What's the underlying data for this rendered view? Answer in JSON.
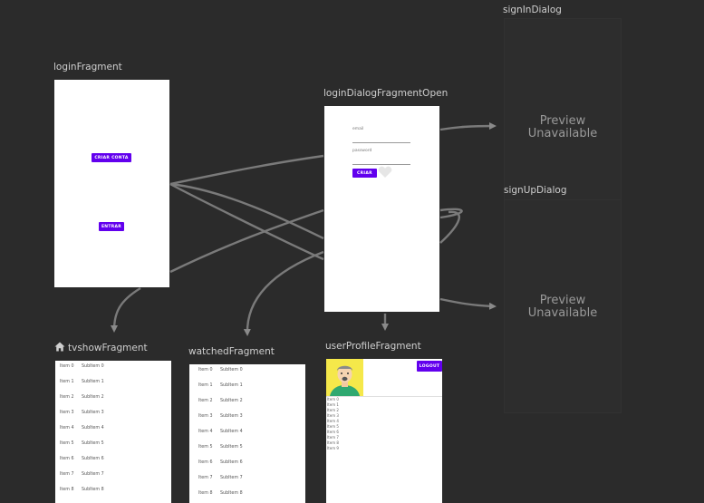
{
  "destinations": {
    "login": {
      "label": "loginFragment",
      "create_button": "CRIAR CONTA",
      "enter_button": "ENTRAR"
    },
    "login_dialog": {
      "label": "loginDialogFragmentOpen",
      "email_label": "email",
      "password_label": "password",
      "submit_button": "CRIAR"
    },
    "sign_in_dialog": {
      "label": "signInDialog",
      "preview_line1": "Preview",
      "preview_line2": "Unavailable"
    },
    "sign_up_dialog": {
      "label": "signUpDialog",
      "preview_line1": "Preview",
      "preview_line2": "Unavailable"
    },
    "tvshow": {
      "label": "tvshowFragment",
      "is_start_destination": true,
      "rows": [
        {
          "item": "Item 0",
          "sub": "SubItem 0"
        },
        {
          "item": "Item 1",
          "sub": "SubItem 1"
        },
        {
          "item": "Item 2",
          "sub": "SubItem 2"
        },
        {
          "item": "Item 3",
          "sub": "SubItem 3"
        },
        {
          "item": "Item 4",
          "sub": "SubItem 4"
        },
        {
          "item": "Item 5",
          "sub": "SubItem 5"
        },
        {
          "item": "Item 6",
          "sub": "SubItem 6"
        },
        {
          "item": "Item 7",
          "sub": "SubItem 7"
        },
        {
          "item": "Item 8",
          "sub": "SubItem 8"
        }
      ]
    },
    "watched": {
      "label": "watchedFragment",
      "rows": [
        {
          "item": "Item 0",
          "sub": "SubItem 0"
        },
        {
          "item": "Item 1",
          "sub": "SubItem 1"
        },
        {
          "item": "Item 2",
          "sub": "SubItem 2"
        },
        {
          "item": "Item 3",
          "sub": "SubItem 3"
        },
        {
          "item": "Item 4",
          "sub": "SubItem 4"
        },
        {
          "item": "Item 5",
          "sub": "SubItem 5"
        },
        {
          "item": "Item 6",
          "sub": "SubItem 6"
        },
        {
          "item": "Item 7",
          "sub": "SubItem 7"
        },
        {
          "item": "Item 8",
          "sub": "SubItem 8"
        }
      ]
    },
    "user_profile": {
      "label": "userProfileFragment",
      "logout_button": "LOGOUT",
      "items": [
        "Item 0",
        "Item 1",
        "Item 2",
        "Item 3",
        "Item 4",
        "Item 5",
        "Item 6",
        "Item 7",
        "Item 8",
        "Item 9"
      ]
    }
  },
  "colors": {
    "canvas": "#2b2b2b",
    "accent": "#6200ee",
    "arrow": "#8a8a8a",
    "label": "#cfcfcf"
  },
  "icons": {
    "start_destination": "home-icon"
  }
}
